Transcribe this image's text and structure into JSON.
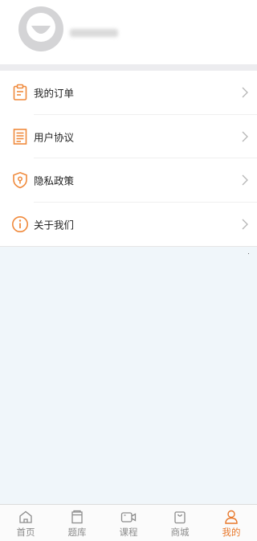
{
  "colors": {
    "accent": "#e8782b",
    "icon_outline": "#f08a3c",
    "inactive_tab": "#8c8c8c",
    "content_bg": "#f0f6fa"
  },
  "profile": {
    "name": "",
    "icon": "avatar-placeholder-icon"
  },
  "menu": {
    "items": [
      {
        "label": "我的订单",
        "icon": "clipboard-icon"
      },
      {
        "label": "用户协议",
        "icon": "document-icon"
      },
      {
        "label": "隐私政策",
        "icon": "shield-icon"
      },
      {
        "label": "关于我们",
        "icon": "info-icon"
      }
    ]
  },
  "tabbar": {
    "tabs": [
      {
        "label": "首页",
        "icon": "home-icon",
        "active": false
      },
      {
        "label": "题库",
        "icon": "question-bank-icon",
        "active": false
      },
      {
        "label": "课程",
        "icon": "video-camera-icon",
        "active": false
      },
      {
        "label": "商城",
        "icon": "shopping-bag-icon",
        "active": false
      },
      {
        "label": "我的",
        "icon": "person-icon",
        "active": true
      }
    ]
  }
}
